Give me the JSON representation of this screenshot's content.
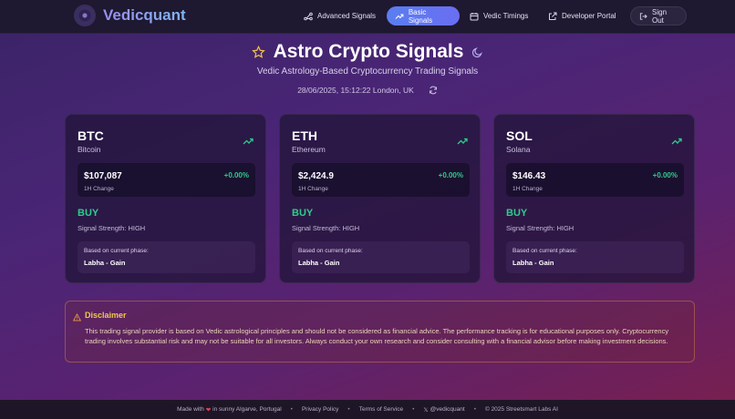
{
  "app": {
    "brand": "Vedicquant"
  },
  "nav": {
    "items": [
      {
        "label": "Advanced Signals",
        "icon": "network-icon"
      },
      {
        "label": "Basic Signals",
        "icon": "trend-up-icon",
        "active": true
      },
      {
        "label": "Vedic Timings",
        "icon": "calendar-icon"
      },
      {
        "label": "Developer Portal",
        "icon": "external-link-icon"
      }
    ],
    "signout": "Sign Out"
  },
  "hero": {
    "title": "Astro Crypto Signals",
    "subtitle": "Vedic Astrology-Based Cryptocurrency Trading Signals",
    "timestamp": "28/06/2025, 15:12:22 London, UK"
  },
  "cards": [
    {
      "symbol": "BTC",
      "name": "Bitcoin",
      "price": "$107,087",
      "change": "+0.00%",
      "change_label": "1H Change",
      "signal": "BUY",
      "strength": "Signal Strength: HIGH",
      "phase_label": "Based on current phase:",
      "phase": "Labha - Gain"
    },
    {
      "symbol": "ETH",
      "name": "Ethereum",
      "price": "$2,424.9",
      "change": "+0.00%",
      "change_label": "1H Change",
      "signal": "BUY",
      "strength": "Signal Strength: HIGH",
      "phase_label": "Based on current phase:",
      "phase": "Labha - Gain"
    },
    {
      "symbol": "SOL",
      "name": "Solana",
      "price": "$146.43",
      "change": "+0.00%",
      "change_label": "1H Change",
      "signal": "BUY",
      "strength": "Signal Strength: HIGH",
      "phase_label": "Based on current phase:",
      "phase": "Labha - Gain"
    }
  ],
  "disclaimer": {
    "title": "Disclaimer",
    "text": "This trading signal provider is based on Vedic astrological principles and should not be considered as financial advice. The performance tracking is for educational purposes only. Cryptocurrency trading involves substantial risk and may not be suitable for all investors. Always conduct your own research and consider consulting with a financial advisor before making investment decisions."
  },
  "footer": {
    "made_prefix": "Made with",
    "made_suffix": "in sunny Algarve, Portugal",
    "privacy": "Privacy Policy",
    "terms": "Terms of Service",
    "handle": "@vedicquant",
    "copyright": "© 2025 Streetsmart Labs AI"
  },
  "colors": {
    "accent": "#5a7ef0",
    "buy": "#2ecc8a",
    "warning": "#f0c94a",
    "heart": "#e0425a"
  }
}
